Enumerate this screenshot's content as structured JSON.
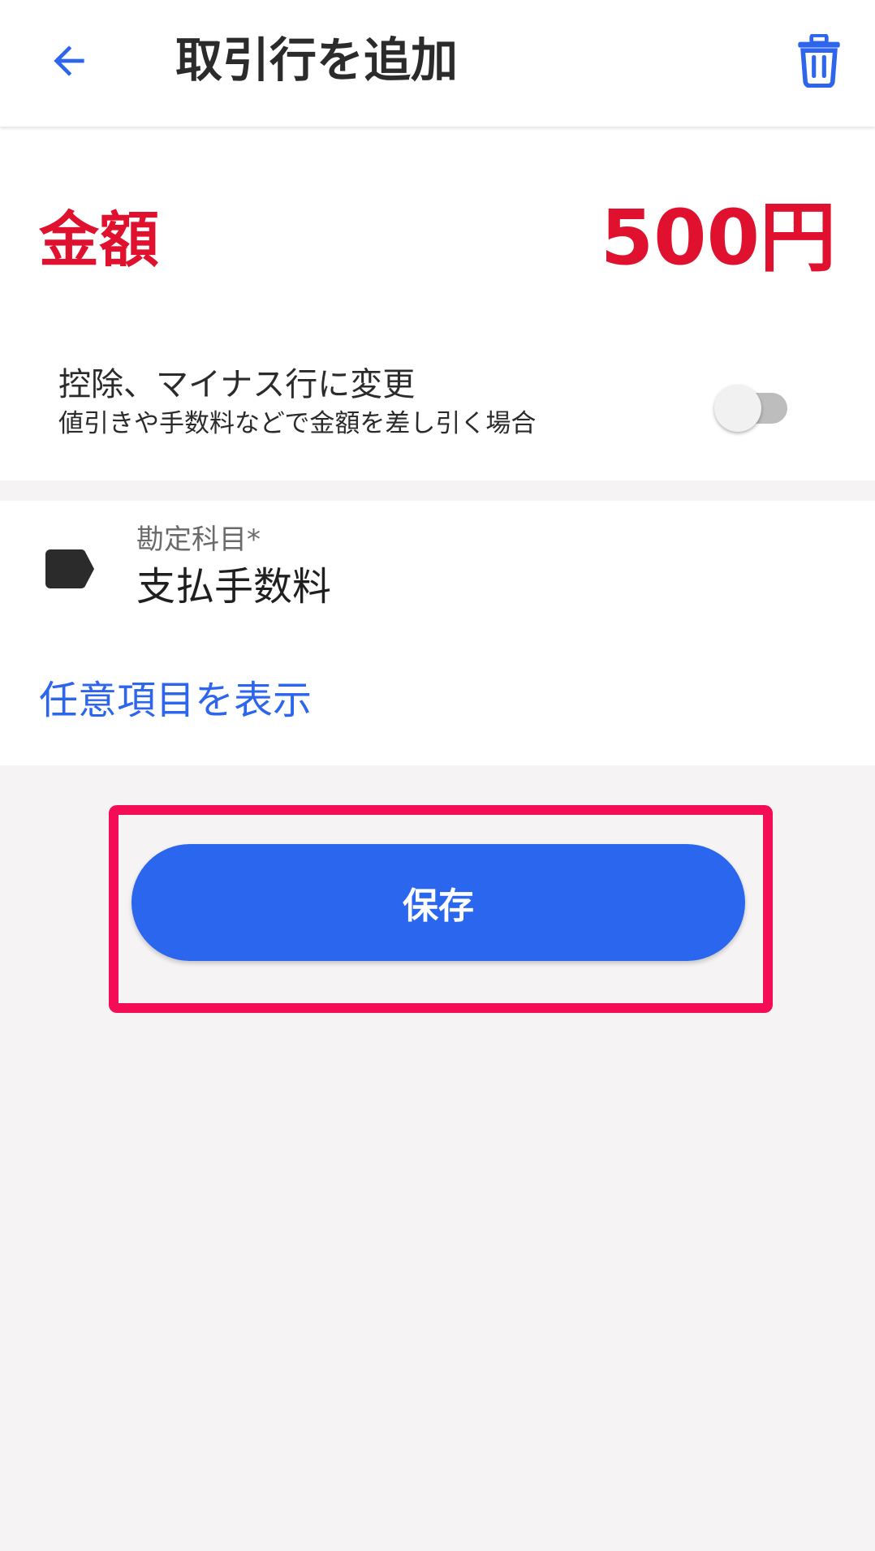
{
  "app_bar": {
    "title": "取引行を追加",
    "back_icon": "arrow-back-icon",
    "trash_icon": "trash-icon"
  },
  "amount": {
    "label": "金額",
    "value": "500円"
  },
  "deduction": {
    "title": "控除、マイナス行に変更",
    "subtitle": "値引きや手数料などで金額を差し引く場合",
    "toggle_on": false
  },
  "account": {
    "label": "勘定科目*",
    "value": "支払手数料",
    "icon": "tag-icon"
  },
  "optional_link": "任意項目を表示",
  "save_button": "保存",
  "colors": {
    "accent_blue": "#2b66ef",
    "amount_red": "#e0112e",
    "highlight_pink": "#f50c57",
    "background": "#f5f3f4"
  }
}
